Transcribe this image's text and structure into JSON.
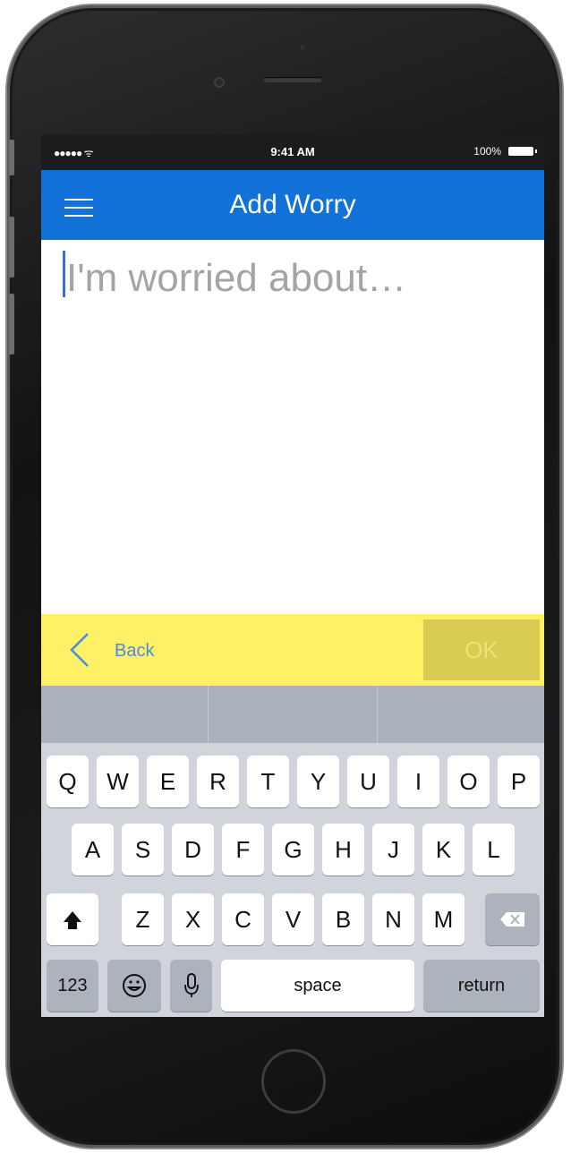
{
  "status_bar": {
    "signal": "●●●●● ᯤ",
    "time": "9:41 AM",
    "battery": "100%"
  },
  "navbar": {
    "title": "Add Worry",
    "menu_icon": "hamburger-menu-icon"
  },
  "editor": {
    "placeholder": "I'm worried about…"
  },
  "actions": {
    "back_label": "Back",
    "ok_label": "OK"
  },
  "keyboard": {
    "row1": [
      "Q",
      "W",
      "E",
      "R",
      "T",
      "Y",
      "U",
      "I",
      "O",
      "P"
    ],
    "row2": [
      "A",
      "S",
      "D",
      "F",
      "G",
      "H",
      "J",
      "K",
      "L"
    ],
    "row3": [
      "Z",
      "X",
      "C",
      "V",
      "B",
      "N",
      "M"
    ],
    "numbers_label": "123",
    "space_label": "space",
    "return_label": "return",
    "icons": [
      "shift-icon",
      "backspace-icon",
      "emoji-icon",
      "microphone-icon"
    ]
  },
  "colors": {
    "navbar": "#1372d8",
    "action_bar": "#fff065",
    "ok_button": "#d9cc52",
    "back_text": "#4a8de0"
  }
}
